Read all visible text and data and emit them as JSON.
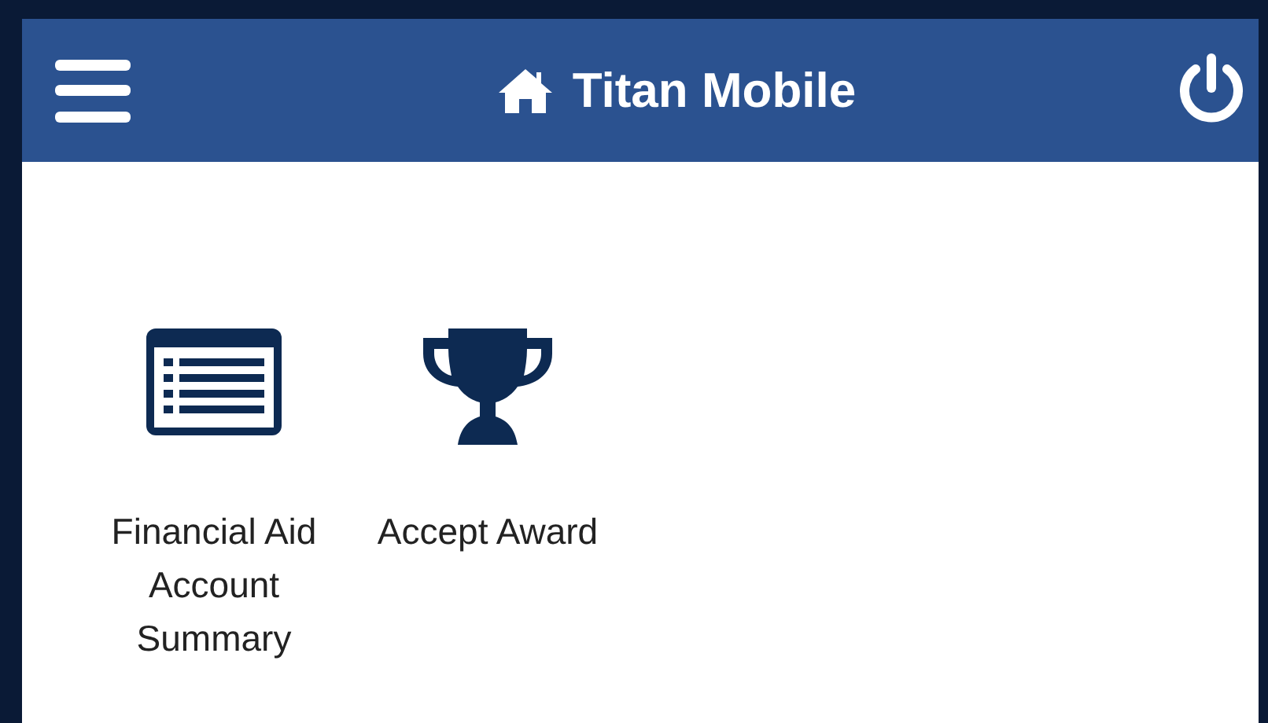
{
  "header": {
    "title": "Titan Mobile"
  },
  "tiles": [
    {
      "kind": "list",
      "label": "Financial Aid Account Summary"
    },
    {
      "kind": "trophy",
      "label": "Accept Award"
    }
  ]
}
